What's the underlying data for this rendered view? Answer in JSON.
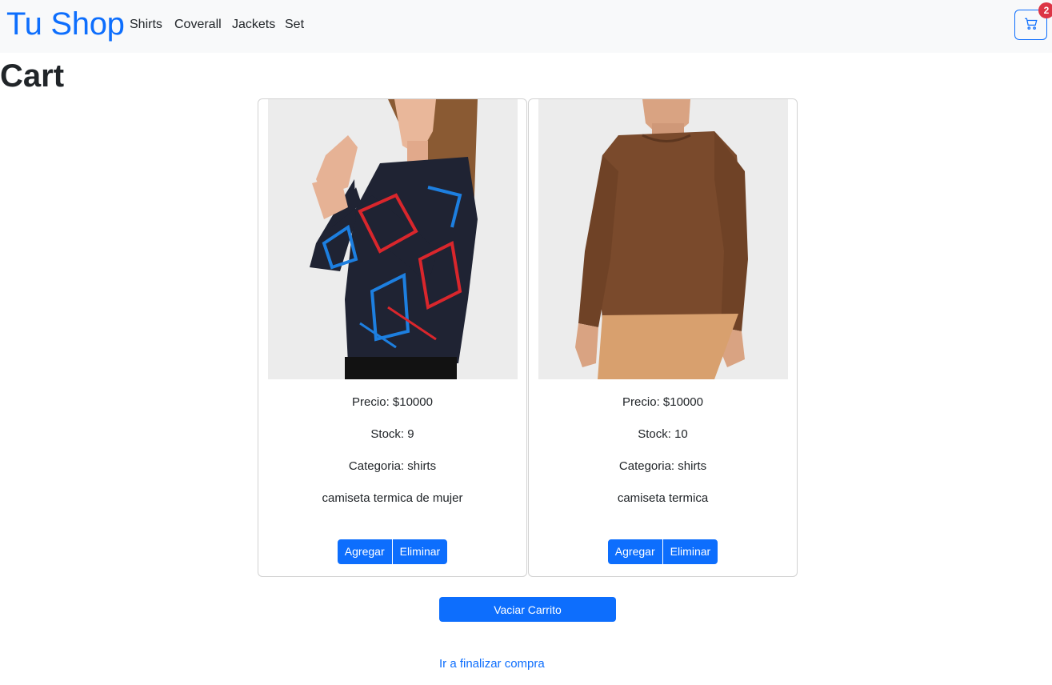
{
  "navbar": {
    "brand": "Tu Shop",
    "links": [
      "Shirts",
      "Coverall",
      "Jackets",
      "Set"
    ],
    "cart_count": "2",
    "cart_icon": "cart-icon",
    "colors": {
      "primary": "#0d6efd",
      "badge": "#dc3545",
      "navbar_bg": "#f8f9fa"
    }
  },
  "page": {
    "title": "Cart"
  },
  "cart": {
    "items": [
      {
        "price": "Precio: $10000",
        "stock": "Stock: 9",
        "category": "Categoria: shirts",
        "description": "camiseta termica de mujer",
        "image": "product-photo-woman-thermal-shirt"
      },
      {
        "price": "Precio: $10000",
        "stock": "Stock: 10",
        "category": "Categoria: shirts",
        "description": "camiseta termica",
        "image": "product-photo-man-thermal-shirt"
      }
    ],
    "add_label": "Agregar",
    "remove_label": "Eliminar",
    "empty_label": "Vaciar Carrito",
    "checkout_label": "Ir a finalizar compra"
  }
}
